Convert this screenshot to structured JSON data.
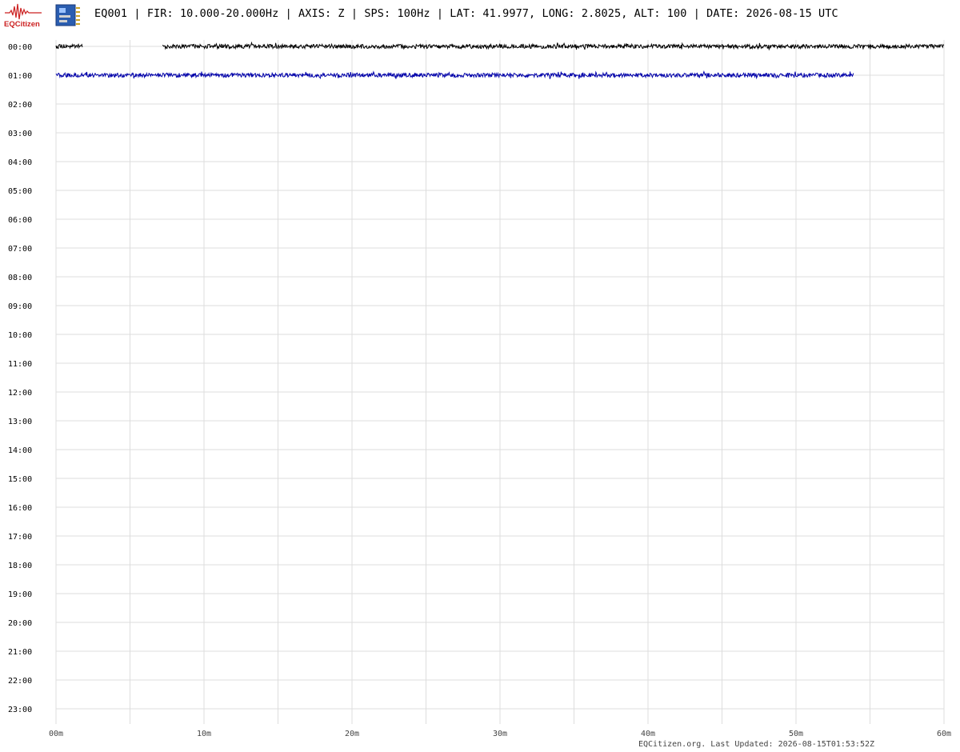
{
  "header": {
    "logo_text": "EQCitizen",
    "title": "EQ001 | FIR: 10.000-20.000Hz | AXIS: Z | SPS: 100Hz | LAT: 41.9977, LONG: 2.8025, ALT: 100 | DATE: 2026-08-15 UTC"
  },
  "footer": {
    "text": "EQCitizen.org. Last Updated: 2026-08-15T01:53:52Z"
  },
  "icons": {
    "logo": "eqcitizen-logo-icon",
    "device": "sensor-device-icon"
  },
  "colors": {
    "grid": "#dddddd",
    "logo": "#cc2222",
    "trace_colors": [
      "#000000",
      "#0000aa"
    ]
  },
  "chart_data": {
    "type": "line",
    "title": "",
    "xlabel": "",
    "ylabel": "",
    "x_unit": "minutes",
    "xlim": [
      0,
      60
    ],
    "x_ticks": [
      {
        "value": 0,
        "label": "00m"
      },
      {
        "value": 10,
        "label": "10m"
      },
      {
        "value": 20,
        "label": "20m"
      },
      {
        "value": 30,
        "label": "30m"
      },
      {
        "value": 40,
        "label": "40m"
      },
      {
        "value": 50,
        "label": "50m"
      },
      {
        "value": 60,
        "label": "60m"
      }
    ],
    "x_minor_gridlines": [
      5,
      15,
      25,
      35,
      45,
      55
    ],
    "y_ticks": [
      "00:00",
      "01:00",
      "02:00",
      "03:00",
      "04:00",
      "05:00",
      "06:00",
      "07:00",
      "08:00",
      "09:00",
      "10:00",
      "11:00",
      "12:00",
      "13:00",
      "14:00",
      "15:00",
      "16:00",
      "17:00",
      "18:00",
      "19:00",
      "20:00",
      "21:00",
      "22:00",
      "23:00"
    ],
    "grid": true,
    "series": [
      {
        "hour": "00:00",
        "color": "#000000",
        "segments": [
          [
            0,
            1.8
          ],
          [
            7.2,
            60
          ]
        ]
      },
      {
        "hour": "01:00",
        "color": "#0000aa",
        "segments": [
          [
            0,
            53.9
          ]
        ]
      }
    ]
  }
}
